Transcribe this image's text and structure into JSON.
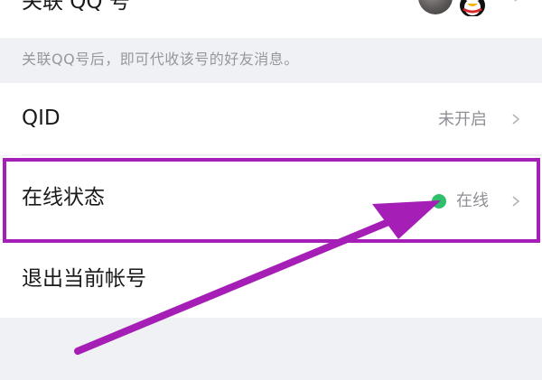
{
  "linked_qq": {
    "label": "关联 QQ 号",
    "hint": "关联QQ号后，即可代收该号的好友消息。"
  },
  "qid": {
    "label": "QID",
    "value": "未开启"
  },
  "online_status": {
    "label": "在线状态",
    "value": "在线"
  },
  "logout": {
    "label": "退出当前帐号"
  },
  "icons": {
    "chevron": "chevron-right-icon",
    "status_dot": "green-dot-icon",
    "avatar_penguin": "qq-penguin-icon"
  },
  "colors": {
    "page_background": "#f0f1f5",
    "status_online": "#2dbf6a",
    "annotation": "#a51fb6"
  }
}
